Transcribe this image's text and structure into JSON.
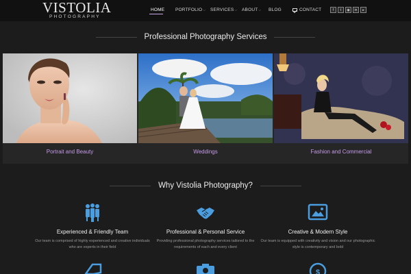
{
  "brand": {
    "name": "VISTOLIA",
    "tagline": "PHOTOGRAPHY"
  },
  "nav": {
    "items": [
      {
        "label": "HOME",
        "active": true
      },
      {
        "label": "PORTFOLIO",
        "caret": true
      },
      {
        "label": "SERVICES",
        "caret": true
      },
      {
        "label": "ABOUT",
        "caret": true
      },
      {
        "label": "BLOG"
      },
      {
        "label": "CONTACT",
        "icon": "envelope-icon"
      }
    ],
    "social_icons": [
      "facebook-icon",
      "twitter-icon",
      "instagram-icon",
      "linkedin-icon",
      "youtube-icon"
    ]
  },
  "services": {
    "title": "Professional Photography Services",
    "cards": [
      {
        "label": "Portrait and Beauty",
        "image": "portrait-photo"
      },
      {
        "label": "Weddings",
        "image": "wedding-photo"
      },
      {
        "label": "Fashion and Commercial",
        "image": "fashion-photo"
      }
    ]
  },
  "why": {
    "title": "Why Vistolia Photography?",
    "features": [
      {
        "icon": "team-icon",
        "title": "Experienced & Friendly Team",
        "desc": "Our team is comprised of highly experienced and creative individuals who are experts in their field"
      },
      {
        "icon": "handshake-icon",
        "title": "Professional & Personal Service",
        "desc": "Providing professional photography services tailored to the requirements of each and every client"
      },
      {
        "icon": "picture-icon",
        "title": "Creative & Modern Style",
        "desc": "Our team is equipped with creativity and vision and our photographic style is contemporary and bold"
      }
    ],
    "more_icons": [
      "tag-icon",
      "camera-icon",
      "dollar-icon"
    ]
  },
  "colors": {
    "accent": "#c79bea",
    "icon_blue": "#4a9ee0",
    "background": "#1c1c1c",
    "header": "#111111"
  }
}
